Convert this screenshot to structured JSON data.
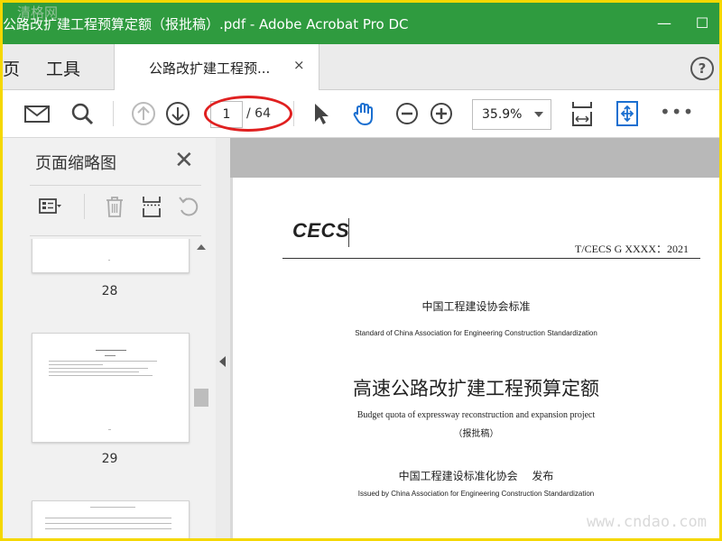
{
  "window": {
    "title": "公路改扩建工程预算定额（报批稿）.pdf - Adobe Acrobat Pro DC",
    "watermark_top": "清格网",
    "minimize_symbol": "—",
    "maximize_symbol": "☐"
  },
  "tabbar": {
    "home_label": "页",
    "tools_label": "工具",
    "doc_tab_label": "公路改扩建工程预...",
    "close_symbol": "×",
    "help_symbol": "?"
  },
  "toolbar": {
    "current_page": "1",
    "page_total": "/ 64",
    "zoom_value": "35.9%",
    "more_symbol": "•••"
  },
  "left_pane": {
    "title": "页面缩略图",
    "close_symbol": "✕",
    "thumbnails": [
      {
        "page_label": "28"
      },
      {
        "page_label": "29"
      }
    ]
  },
  "document": {
    "logo_text": "CECS",
    "code": "T/CECS G XXXX：2021",
    "org_cn": "中国工程建设协会标准",
    "org_en": "Standard of China Association for Engineering Construction Standardization",
    "title_cn": "高速公路改扩建工程预算定额",
    "title_en": "Budget quota of expressway reconstruction and expansion project",
    "draft_label": "（报批稿）",
    "issuer_cn": "中国工程建设标准化协会　 发布",
    "issuer_en": "Issued by China Association for Engineering Construction Standardization"
  },
  "watermark_bottom": "www.cndao.com",
  "colors": {
    "title_bar": "#2f9b3f",
    "annotation_circle": "#e02020",
    "accent_icon_blue": "#1a6fd0"
  }
}
